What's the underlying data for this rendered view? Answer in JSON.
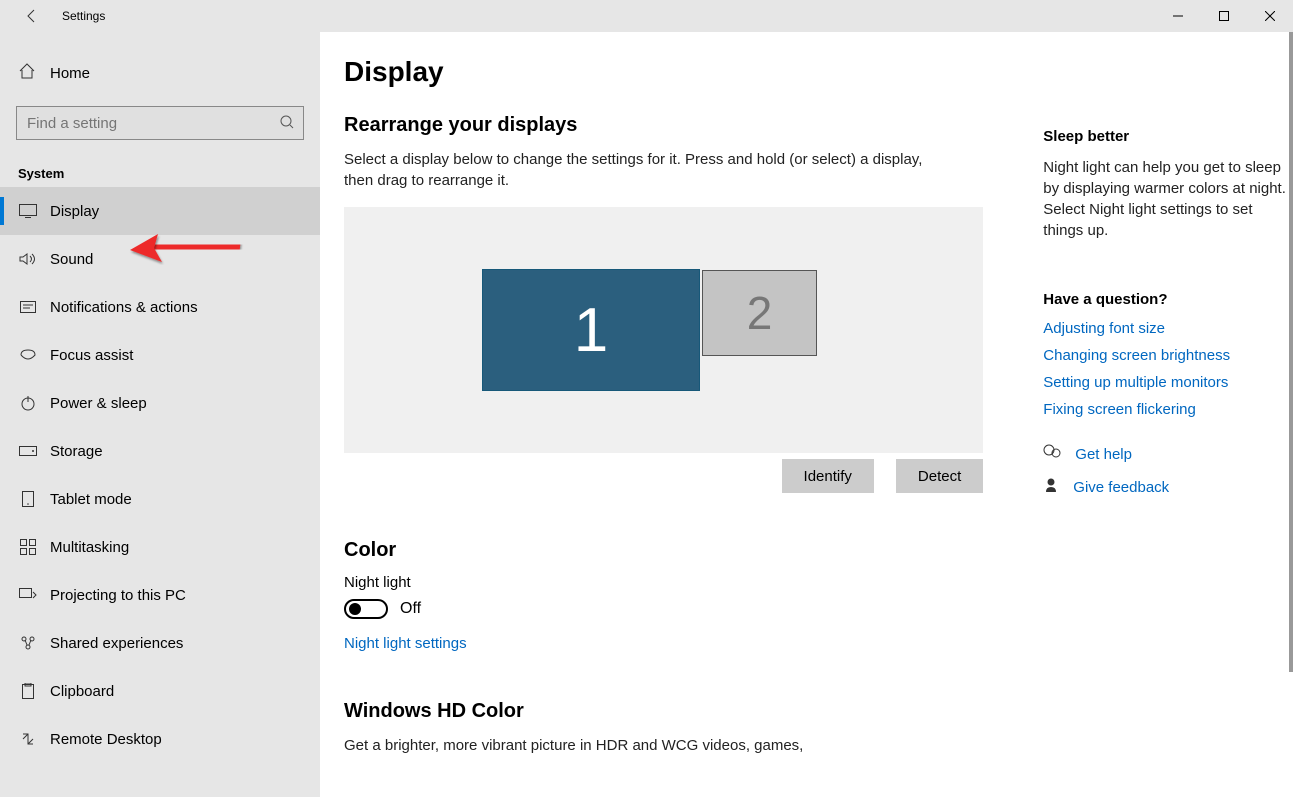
{
  "titlebar": {
    "title": "Settings"
  },
  "sidebar": {
    "home": "Home",
    "search_placeholder": "Find a setting",
    "category": "System",
    "items": [
      {
        "label": "Display",
        "active": true
      },
      {
        "label": "Sound"
      },
      {
        "label": "Notifications & actions"
      },
      {
        "label": "Focus assist"
      },
      {
        "label": "Power & sleep"
      },
      {
        "label": "Storage"
      },
      {
        "label": "Tablet mode"
      },
      {
        "label": "Multitasking"
      },
      {
        "label": "Projecting to this PC"
      },
      {
        "label": "Shared experiences"
      },
      {
        "label": "Clipboard"
      },
      {
        "label": "Remote Desktop"
      }
    ]
  },
  "page": {
    "title": "Display",
    "rearrange_title": "Rearrange your displays",
    "rearrange_desc": "Select a display below to change the settings for it. Press and hold (or select) a display, then drag to rearrange it.",
    "monitor1": "1",
    "monitor2": "2",
    "identify": "Identify",
    "detect": "Detect",
    "color_title": "Color",
    "night_light_label": "Night light",
    "night_light_state": "Off",
    "night_light_link": "Night light settings",
    "hd_title": "Windows HD Color",
    "hd_desc": "Get a brighter, more vibrant picture in HDR and WCG videos, games,"
  },
  "right": {
    "sleep_title": "Sleep better",
    "sleep_text": "Night light can help you get to sleep by displaying warmer colors at night. Select Night light settings to set things up.",
    "question": "Have a question?",
    "links": [
      "Adjusting font size",
      "Changing screen brightness",
      "Setting up multiple monitors",
      "Fixing screen flickering"
    ],
    "help": "Get help",
    "feedback": "Give feedback"
  }
}
